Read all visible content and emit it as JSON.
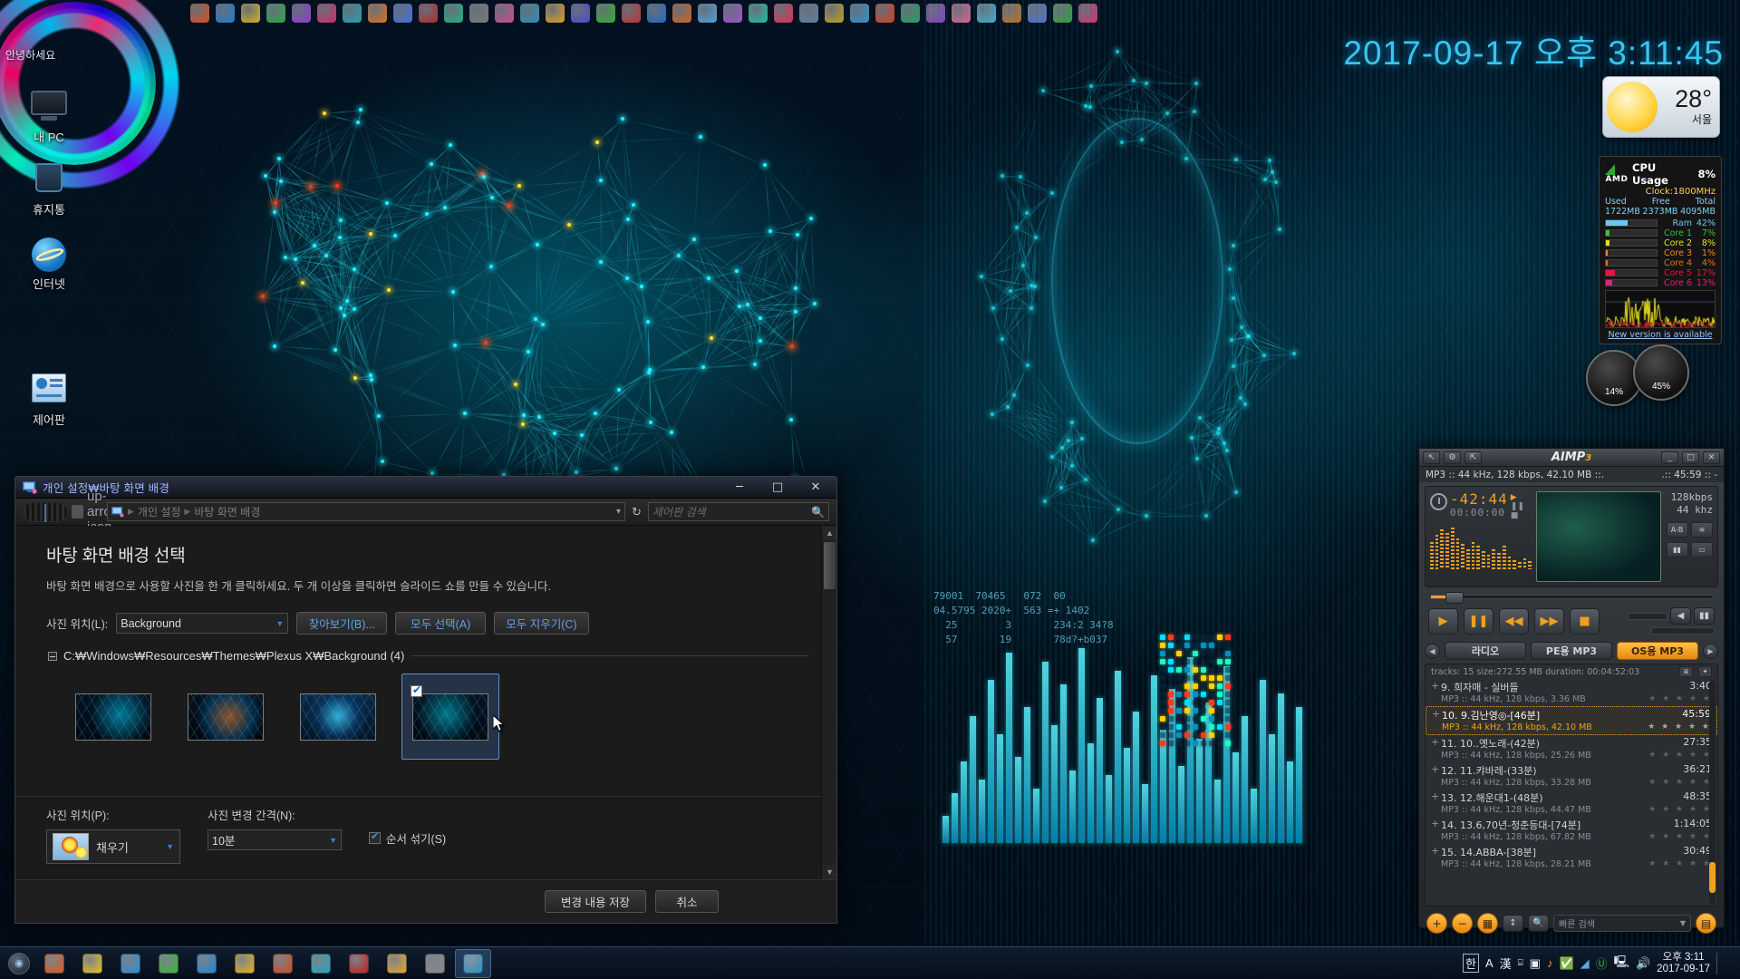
{
  "desktop": {
    "icons": [
      {
        "label": "내 PC",
        "icon": "computer-icon"
      },
      {
        "label": "휴지통",
        "icon": "recycle-bin-icon"
      },
      {
        "label": "인터넷",
        "icon": "internet-explorer-icon"
      },
      {
        "label": "제어판",
        "icon": "control-panel-icon"
      }
    ],
    "greeting": "안녕하세요"
  },
  "clock_widget": {
    "datetime": "2017-09-17 오후 3:11:45"
  },
  "weather_widget": {
    "temperature": "28°",
    "city": "서울",
    "icon": "sun-icon"
  },
  "cpu_widget": {
    "title": "CPU Usage",
    "usage": "8%",
    "vendor": "AMD",
    "clock_label": "Clock",
    "clock_value": "1800MHz",
    "mem_headers": [
      "Used",
      "Free",
      "Total"
    ],
    "mem_values": [
      "1722MB",
      "2373MB",
      "4095MB"
    ],
    "bars": [
      {
        "label": "Ram",
        "value": "42%",
        "pct": 42,
        "color": "#6cc8f0"
      },
      {
        "label": "Core 1",
        "value": "7%",
        "pct": 7,
        "color": "#3fbf3f"
      },
      {
        "label": "Core 2",
        "value": "8%",
        "pct": 8,
        "color": "#e4e020"
      },
      {
        "label": "Core 3",
        "value": "1%",
        "pct": 1,
        "color": "#f08a20"
      },
      {
        "label": "Core 4",
        "value": "4%",
        "pct": 4,
        "color": "#f06a18"
      },
      {
        "label": "Core 5",
        "value": "17%",
        "pct": 17,
        "color": "#e01840"
      },
      {
        "label": "Core 6",
        "value": "13%",
        "pct": 13,
        "color": "#e0247a"
      }
    ],
    "update_link": "New version is available"
  },
  "gauges": [
    {
      "value": "14%"
    },
    {
      "value": "45%"
    }
  ],
  "window": {
    "title": "개인 설정₩바탕 화면 배경",
    "title_icon": "personalization-icon",
    "minimize": "─",
    "maximize": "□",
    "close": "✕",
    "breadcrumb": {
      "root_icon": "personalization-icon",
      "parts": [
        "개인 설정",
        "바탕 화면 배경"
      ]
    },
    "address_caret": "▾",
    "refresh_icon": "refresh-icon",
    "search_placeholder": "제어판 검색",
    "search_icon": "search-icon",
    "up_icon": "up-arrow-icon",
    "heading": "바탕 화면 배경 선택",
    "subtext": "바탕 화면 배경으로 사용할 사진을 한 개 클릭하세요. 두 개 이상을 클릭하면 슬라이드 쇼를 만들 수 있습니다.",
    "location_label": "사진 위치(L):",
    "location_value": "Background",
    "buttons": {
      "browse": "찾아보기(B)...",
      "select_all": "모두 선택(A)",
      "clear_all": "모두 지우기(C)",
      "save": "변경 내용 저장",
      "cancel": "취소"
    },
    "group_path": "C:₩Windows₩Resources₩Themes₩Plexus X₩Background (4)",
    "thumbnails": [
      {
        "name": "plexus-thumb-1",
        "selected": false,
        "checked": false
      },
      {
        "name": "plexus-thumb-2",
        "selected": false,
        "checked": false
      },
      {
        "name": "plexus-thumb-3",
        "selected": false,
        "checked": false
      },
      {
        "name": "plexus-thumb-4",
        "selected": true,
        "checked": true
      }
    ],
    "picture_position_label": "사진 위치(P):",
    "picture_position_value": "채우기",
    "interval_label": "사진 변경 간격(N):",
    "interval_value": "10분",
    "shuffle_label": "순서 섞기(S)",
    "shuffle_checked": true
  },
  "aimp": {
    "app_name": "AIMP",
    "app_suffix": "3",
    "title_buttons": [
      "↖",
      "⚙",
      "⇱"
    ],
    "window_buttons": [
      "_",
      "□",
      "✕"
    ],
    "now_playing_info": "MP3 :: 44 kHz, 128 kbps, 42.10 MB ::.",
    "total_time": ".:: 45:59 :: -",
    "elapsed": "-42:44",
    "remaining": "00:00:00",
    "bitrate": "128kbps",
    "samplerate": "44 khz",
    "side_buttons": [
      "A-B",
      "wifi-icon",
      "equalizer-icon",
      "output-icon"
    ],
    "transport": [
      "play",
      "pause",
      "prev",
      "next",
      "stop"
    ],
    "playlist_tabs": [
      {
        "label": "라디오",
        "active": false
      },
      {
        "label": "PE용 MP3",
        "active": false
      },
      {
        "label": "OS용 MP3",
        "active": true
      }
    ],
    "playlist_summary": "tracks: 15   size:272.55 MB duration: 00:04:52:03",
    "tracks": [
      {
        "index": "9.",
        "title": "희자매 - 실버들",
        "time": "3:40",
        "meta": "MP3 :: 44 kHz, 128 kbps, 3.36 MB",
        "current": false
      },
      {
        "index": "10.",
        "title": "9.김난영◎-[46분]",
        "time": "45:59",
        "meta": "MP3 :: 44 kHz, 128 kbps, 42.10 MB",
        "current": true
      },
      {
        "index": "11.",
        "title": "10..옛노래-(42분)",
        "time": "27:35",
        "meta": "MP3 :: 44 kHz, 128 kbps, 25.26 MB",
        "current": false
      },
      {
        "index": "12.",
        "title": "11.캬바레-(33분)",
        "time": "36:21",
        "meta": "MP3 :: 44 kHz, 128 kbps, 33.28 MB",
        "current": false
      },
      {
        "index": "13.",
        "title": "12.해운대1-(48분)",
        "time": "48:35",
        "meta": "MP3 :: 44 kHz, 128 kbps, 44.47 MB",
        "current": false
      },
      {
        "index": "14.",
        "title": "13.6,70년-청춘등대-[74분]",
        "time": "1:14:05",
        "meta": "MP3 :: 44 kHz, 128 kbps, 67.82 MB",
        "current": false
      },
      {
        "index": "15.",
        "title": "14.ABBA-[38분]",
        "time": "30:49",
        "meta": "MP3 :: 44 kHz, 128 kbps, 28.21 MB",
        "current": false
      }
    ],
    "stars": "★ ★ ★ ★ ★",
    "quick_search_placeholder": "빠른 검색",
    "bottom_buttons": [
      "add",
      "remove",
      "shuffle-grid",
      "sort",
      "find",
      "save"
    ]
  },
  "taskbar": {
    "start_icon": "start-orb-icon",
    "items": [
      "firefox-icon",
      "chrome-icon",
      "sync-icon",
      "utorrent-icon",
      "edge-icon",
      "folder-icon",
      "store-icon",
      "video-icon",
      "mail-icon",
      "folder2-icon",
      "box-icon",
      "aimp-taskbar-icon"
    ],
    "tray": {
      "ime_korean": "한",
      "ime_alpha": "A",
      "ime_hanja": "漢",
      "icons": [
        "monitor-icon",
        "music-icon",
        "shield-icon",
        "volume40-icon",
        "utorrent-tray-icon",
        "network-icon",
        "speaker-icon"
      ],
      "time": "오후 3:11",
      "date": "2017-09-17",
      "show_desktop": "show-desktop-button"
    }
  }
}
